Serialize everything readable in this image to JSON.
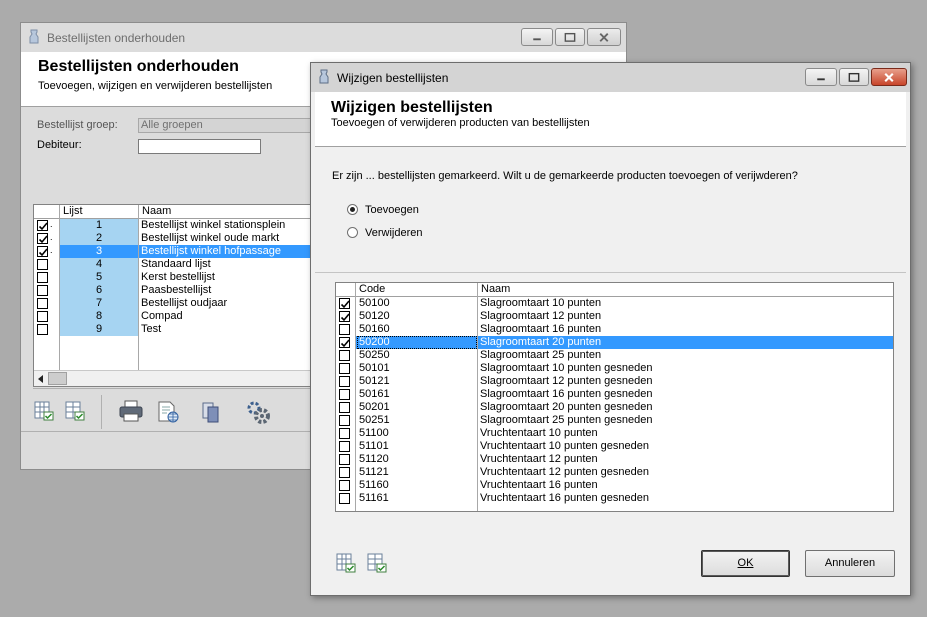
{
  "back_window": {
    "title": "Bestellijsten onderhouden",
    "header_title": "Bestellijsten onderhouden",
    "header_subtitle": "Toevoegen, wijzigen en verwijderen bestellijsten",
    "group_label": "Bestellijst groep:",
    "group_value": "Alle groepen",
    "debtor_label": "Debiteur:",
    "debtor_value": "",
    "grid": {
      "col_lijst": "Lijst",
      "col_naam": "Naam",
      "rows": [
        {
          "nr": "1",
          "naam": "Bestellijst winkel stationsplein",
          "checked": true
        },
        {
          "nr": "2",
          "naam": "Bestellijst winkel oude markt",
          "checked": true
        },
        {
          "nr": "3",
          "naam": "Bestellijst winkel hofpassage",
          "checked": true,
          "selected": true
        },
        {
          "nr": "4",
          "naam": "Standaard lijst",
          "checked": false
        },
        {
          "nr": "5",
          "naam": "Kerst bestellijst",
          "checked": false
        },
        {
          "nr": "6",
          "naam": "Paasbestellijst",
          "checked": false
        },
        {
          "nr": "7",
          "naam": "Bestellijst oudjaar",
          "checked": false
        },
        {
          "nr": "8",
          "naam": "Compad",
          "checked": false
        },
        {
          "nr": "9",
          "naam": "Test",
          "checked": false
        }
      ]
    },
    "toolbar_icons": [
      "check-all-icon",
      "uncheck-all-icon",
      "print-icon",
      "export-icon",
      "copy-icon",
      "settings-icon"
    ]
  },
  "dialog": {
    "title": "Wijzigen bestellijsten",
    "header_title": "Wijzigen bestellijsten",
    "header_subtitle": "Toevoegen of verwijderen producten van bestellijsten",
    "question": "Er zijn ... bestellijsten gemarkeerd. Wilt u de gemarkeerde producten toevoegen of verijwderen?",
    "option_add": "Toevoegen",
    "option_remove": "Verwijderen",
    "selected_option": "add",
    "grid": {
      "col_code": "Code",
      "col_naam": "Naam",
      "rows": [
        {
          "code": "50100",
          "naam": "Slagroomtaart 10 punten",
          "checked": true
        },
        {
          "code": "50120",
          "naam": "Slagroomtaart 12 punten",
          "checked": true
        },
        {
          "code": "50160",
          "naam": "Slagroomtaart 16 punten",
          "checked": false
        },
        {
          "code": "50200",
          "naam": "Slagroomtaart 20 punten",
          "checked": true,
          "selected": true
        },
        {
          "code": "50250",
          "naam": "Slagroomtaart 25 punten",
          "checked": false
        },
        {
          "code": "50101",
          "naam": "Slagroomtaart 10 punten gesneden",
          "checked": false
        },
        {
          "code": "50121",
          "naam": "Slagroomtaart 12 punten gesneden",
          "checked": false
        },
        {
          "code": "50161",
          "naam": "Slagroomtaart 16 punten gesneden",
          "checked": false
        },
        {
          "code": "50201",
          "naam": "Slagroomtaart 20 punten gesneden",
          "checked": false
        },
        {
          "code": "50251",
          "naam": "Slagroomtaart 25 punten gesneden",
          "checked": false
        },
        {
          "code": "51100",
          "naam": "Vruchtentaart 10 punten",
          "checked": false
        },
        {
          "code": "51101",
          "naam": "Vruchtentaart 10 punten gesneden",
          "checked": false
        },
        {
          "code": "51120",
          "naam": "Vruchtentaart 12 punten",
          "checked": false
        },
        {
          "code": "51121",
          "naam": "Vruchtentaart 12 punten gesneden",
          "checked": false
        },
        {
          "code": "51160",
          "naam": "Vruchtentaart 16 punten",
          "checked": false
        },
        {
          "code": "51161",
          "naam": "Vruchtentaart 16 punten gesneden",
          "checked": false
        }
      ]
    },
    "ok_label": "OK",
    "cancel_label": "Annuleren"
  }
}
